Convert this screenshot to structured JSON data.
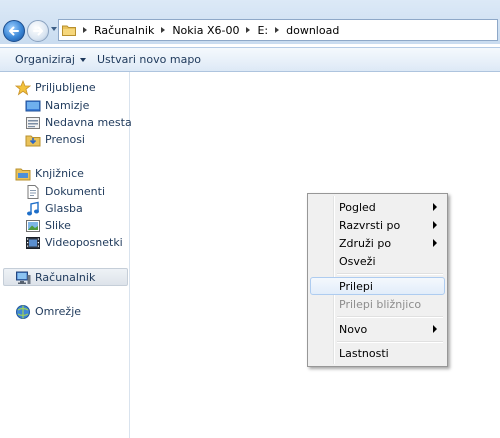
{
  "address_bar": {
    "crumbs": [
      "Računalnik",
      "Nokia X6-00",
      "E:",
      "download"
    ]
  },
  "command_bar": {
    "organize_label": "Organiziraj",
    "new_folder_label": "Ustvari novo mapo"
  },
  "nav_pane": {
    "favorites": {
      "label": "Priljubljene",
      "items": [
        {
          "label": "Namizje",
          "icon": "desktop-icon"
        },
        {
          "label": "Nedavna mesta",
          "icon": "recent-places-icon"
        },
        {
          "label": "Prenosi",
          "icon": "downloads-icon"
        }
      ]
    },
    "libraries": {
      "label": "Knjižnice",
      "items": [
        {
          "label": "Dokumenti",
          "icon": "documents-icon"
        },
        {
          "label": "Glasba",
          "icon": "music-icon"
        },
        {
          "label": "Slike",
          "icon": "pictures-icon"
        },
        {
          "label": "Videoposnetki",
          "icon": "videos-icon"
        }
      ]
    },
    "computer": {
      "label": "Računalnik",
      "selected": true
    },
    "network": {
      "label": "Omrežje"
    }
  },
  "context_menu": {
    "items": [
      {
        "label": "Pogled",
        "submenu": true
      },
      {
        "label": "Razvrsti po",
        "submenu": true
      },
      {
        "label": "Združi po",
        "submenu": true
      },
      {
        "label": "Osveži",
        "submenu": false
      },
      {
        "label": "Prilepi",
        "submenu": false,
        "highlighted": true
      },
      {
        "label": "Prilepi bližnjico",
        "submenu": false,
        "disabled": true
      },
      {
        "label": "Novo",
        "submenu": true
      },
      {
        "label": "Lastnosti",
        "submenu": false
      }
    ]
  },
  "colors": {
    "chrome_top": "#dce9f7",
    "nav_text": "#1e395b",
    "menu_bg": "#f0f0f0",
    "menu_border": "#979797",
    "menu_highlight_border": "#aeccf0"
  }
}
